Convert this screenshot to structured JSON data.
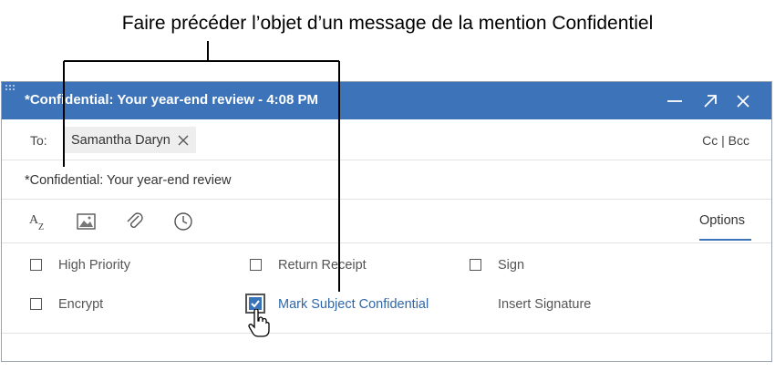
{
  "annotation": {
    "text": "Faire précéder l’objet d’un message de la mention Confidentiel"
  },
  "window": {
    "title": "*Confidential: Your year-end review - 4:08 PM",
    "controls": [
      "minimize-icon",
      "pop-out-icon",
      "close-icon"
    ]
  },
  "to": {
    "label": "To:",
    "recipient": "Samantha Daryn",
    "cc_bcc": "Cc | Bcc"
  },
  "subject": {
    "value": "*Confidential: Your year-end review"
  },
  "toolbar": {
    "icons": [
      "text-format-icon",
      "image-icon",
      "attachment-icon",
      "clock-icon"
    ],
    "options_tab": "Options"
  },
  "options": {
    "high_priority": {
      "label": "High Priority",
      "checked": false
    },
    "return_receipt": {
      "label": "Return Receipt",
      "checked": false
    },
    "sign": {
      "label": "Sign",
      "checked": false
    },
    "encrypt": {
      "label": "Encrypt",
      "checked": false
    },
    "mark_confidential": {
      "label": "Mark Subject Confidential",
      "checked": true
    },
    "insert_signature": {
      "label": "Insert Signature"
    }
  },
  "colors": {
    "titlebar": "#3c73b9",
    "accent": "#3a73b8"
  }
}
